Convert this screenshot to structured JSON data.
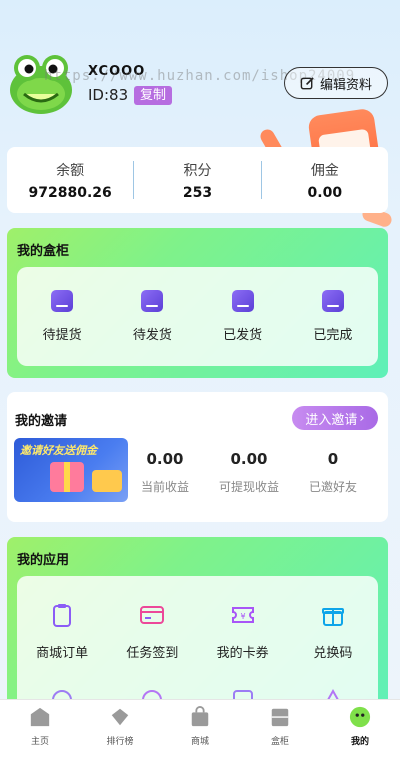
{
  "header": {
    "username": "XCOOO",
    "user_id": "ID:83",
    "copy_label": "复制",
    "edit_label": "编辑资料",
    "watermark": "https://www.huzhan.com/ishop24009"
  },
  "balance": {
    "items": [
      {
        "label": "余额",
        "value": "972880.26"
      },
      {
        "label": "积分",
        "value": "253"
      },
      {
        "label": "佣金",
        "value": "0.00"
      }
    ]
  },
  "cabinet": {
    "title": "我的盒柜",
    "items": [
      {
        "label": "待提货",
        "icon": "box-all-icon"
      },
      {
        "label": "待发货",
        "icon": "box-ship-icon"
      },
      {
        "label": "已发货",
        "icon": "box-sent-icon"
      },
      {
        "label": "已完成",
        "icon": "box-done-icon"
      }
    ]
  },
  "invite": {
    "title": "我的邀请",
    "button_label": "进入邀请",
    "banner_text": "邀请好友送佣金",
    "stats": [
      {
        "value": "0.00",
        "label": "当前收益"
      },
      {
        "value": "0.00",
        "label": "可提现收益"
      },
      {
        "value": "0",
        "label": "已邀好友"
      }
    ]
  },
  "apps": {
    "title": "我的应用",
    "items": [
      {
        "label": "商城订单",
        "icon": "clipboard-icon",
        "color": "#8b5cf6"
      },
      {
        "label": "任务签到",
        "icon": "card-icon",
        "color": "#ec4899"
      },
      {
        "label": "我的卡券",
        "icon": "ticket-icon",
        "color": "#a855f7"
      },
      {
        "label": "兑换码",
        "icon": "gift-icon",
        "color": "#0ea5e9"
      }
    ]
  },
  "tabbar": {
    "items": [
      {
        "label": "主页",
        "icon": "home-icon"
      },
      {
        "label": "排行榜",
        "icon": "ranking-icon"
      },
      {
        "label": "商城",
        "icon": "shop-bag-icon"
      },
      {
        "label": "盒柜",
        "icon": "cabinet-icon"
      },
      {
        "label": "我的",
        "icon": "profile-icon",
        "active": true
      }
    ]
  },
  "colors": {
    "accent_purple": "#b66de0",
    "green_start": "#9ff06a",
    "green_end": "#5ff0b8"
  }
}
